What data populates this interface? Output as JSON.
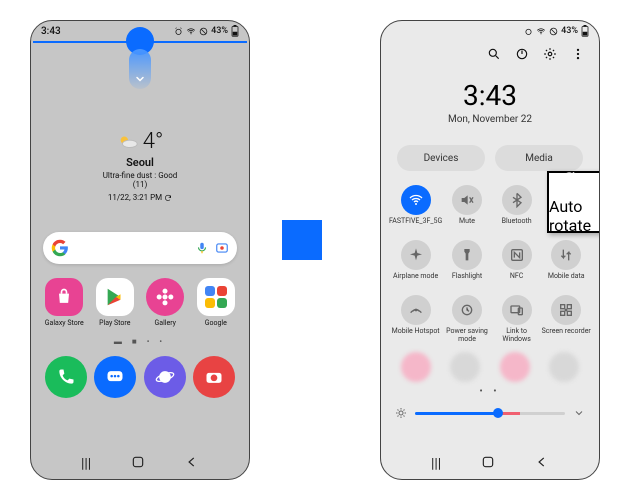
{
  "status": {
    "time": "3:43",
    "battery": "43%"
  },
  "left": {
    "weather": {
      "temp": "4°",
      "city": "Seoul",
      "dust_line": "Ultra-fine dust : Good",
      "dust_value": "(11)",
      "datetime": "11/22, 3:21 PM"
    },
    "apps": [
      {
        "label": "Galaxy Store"
      },
      {
        "label": "Play Store"
      },
      {
        "label": "Gallery"
      },
      {
        "label": "Google"
      }
    ]
  },
  "right": {
    "clock": {
      "time": "3:43",
      "date": "Mon, November 22"
    },
    "chips": {
      "devices": "Devices",
      "media": "Media"
    },
    "tiles": [
      {
        "label": "FASTFIVE_3F_5G",
        "on": true
      },
      {
        "label": "Mute",
        "on": false
      },
      {
        "label": "Bluetooth",
        "on": false
      },
      {
        "label": "Auto rotate",
        "on": true
      },
      {
        "label": "Airplane mode",
        "on": false
      },
      {
        "label": "Flashlight",
        "on": false
      },
      {
        "label": "NFC",
        "on": false
      },
      {
        "label": "Mobile data",
        "on": false
      },
      {
        "label": "Mobile Hotspot",
        "on": false
      },
      {
        "label": "Power saving mode",
        "on": false
      },
      {
        "label": "Link to Windows",
        "on": false
      },
      {
        "label": "Screen recorder",
        "on": false
      }
    ]
  }
}
